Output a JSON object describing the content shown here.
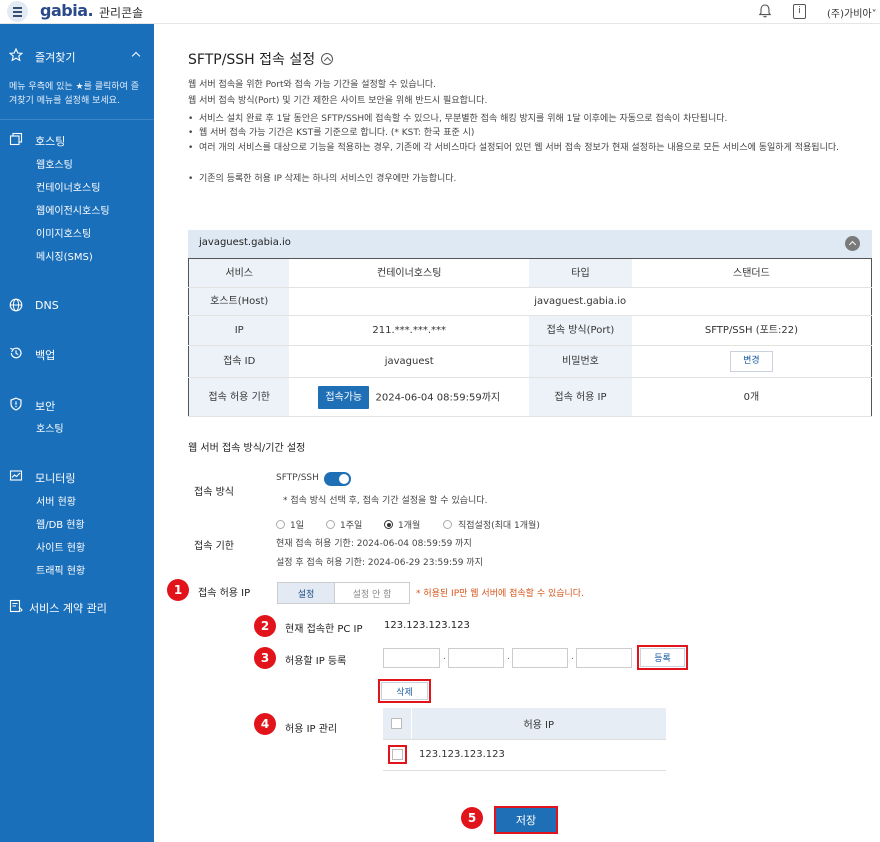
{
  "header": {
    "logo": "gabia.",
    "console_label": "관리콘솔",
    "company": "(주)가비아",
    "company_chevron": "˅",
    "info_icon_glyph": "i"
  },
  "sidebar": {
    "favorites": {
      "label": "즐겨찾기",
      "description_line1": "메뉴 우측에 있는 ★를 클릭하여 즐",
      "description_line2": "겨찾기 메뉴를 설정해 보세요."
    },
    "hosting": {
      "label": "호스팅",
      "items": [
        "웹호스팅",
        "컨테이너호스팅",
        "웹에이전시호스팅",
        "이미지호스팅",
        "메시징(SMS)"
      ]
    },
    "dns": {
      "label": "DNS"
    },
    "backup": {
      "label": "백업"
    },
    "security": {
      "label": "보안",
      "items": [
        "호스팅"
      ]
    },
    "monitoring": {
      "label": "모니터링",
      "items": [
        "서버 현황",
        "웹/DB 현황",
        "사이트 현황",
        "트래픽 현황"
      ]
    },
    "contract": {
      "label": "서비스 계약 관리"
    },
    "accent_color": "#1a6fbb"
  },
  "main": {
    "title": "SFTP/SSH 접속 설정",
    "desc_line1": "웹 서버 접속을 위한 Port와 접속 가능 기간을 설정할 수 있습니다.",
    "desc_line2": "웹 서버 접속 방식(Port) 및 기간 제한은 사이트 보안을 위해 반드시 필요합니다.",
    "bullets": [
      "서비스 설치 완료 후 1달 동안은 SFTP/SSH에 접속할 수 있으나, 무분별한 접속 해킹 방지를 위해 1달 이후에는 자동으로 접속이 차단됩니다.",
      "웹 서버 접속 가능 기간은 KST를 기준으로 합니다. (* KST: 한국 표준 시)",
      "여러 개의 서비스를 대상으로 기능을 적용하는 경우, 기존에 각 서비스마다 설정되어 있던 웹 서버 접속 정보가 현재 설정하는 내용으로 모든 서비스에 동일하게 적용됩니다.",
      "기존의 등록한 허용 IP 삭제는 하나의 서비스인 경우에만 가능합니다."
    ],
    "server_box": {
      "host_title": "javaguest.gabia.io",
      "service_label": "서비스",
      "service_value": "컨테이너호스팅",
      "type_label": "타입",
      "type_value": "스탠더드",
      "host_label": "호스트(Host)",
      "host_value": "javaguest.gabia.io",
      "ip_label": "IP",
      "ip_value": "211.***.***.***",
      "port_label": "접속 방식(Port)",
      "port_value": "SFTP/SSH (포트:22)",
      "id_label": "접속 ID",
      "id_value": "javaguest",
      "pw_label": "비밀번호",
      "pw_button": "변경",
      "period_label": "접속 허용 기한",
      "period_badge": "접속가능",
      "period_value": "2024-06-04 08:59:59까지",
      "allowed_ip_label": "접속 허용 IP",
      "allowed_ip_value": "0개"
    },
    "settings": {
      "section_title": "웹 서버 접속 방식/기간 설정",
      "method_label": "접속 방식",
      "method_value": "SFTP/SSH",
      "method_enabled": true,
      "method_note": "* 접속 방식 선택 후, 접속 기간 설정을 할 수 있습니다.",
      "period_label": "접속 기한",
      "period_options": [
        "1일",
        "1주일",
        "1개월",
        "직접설정(최대 1개월)"
      ],
      "period_selected": "1개월",
      "current_period": "현재 접속 허용 기한: 2024-06-04 08:59:59 까지",
      "after_period": "설정 후 접속 허용 기한: 2024-06-29 23:59:59 까지",
      "allowed_ip_label": "접속 허용 IP",
      "allowed_ip_options": [
        "설정",
        "설정 안 함"
      ],
      "allowed_ip_selected": "설정",
      "allowed_ip_warning": "* 허용된 IP만 웹 서버에 접속할 수 있습니다.",
      "current_pc_ip_label": "현재 접속한 PC IP",
      "current_pc_ip_value": "123.123.123.123",
      "register_ip_label": "허용할 IP 등록",
      "ip_octets": [
        "",
        "",
        "",
        ""
      ],
      "register_button": "등록",
      "delete_button": "삭제",
      "manage_label": "허용 IP 관리",
      "ip_table_header": "허용 IP",
      "ip_table_rows": [
        "123.123.123.123"
      ],
      "save_button": "저장"
    },
    "callouts": [
      "1",
      "2",
      "3",
      "4",
      "5"
    ],
    "callout_color": "#e2141b",
    "warning_color": "#d4561b"
  }
}
